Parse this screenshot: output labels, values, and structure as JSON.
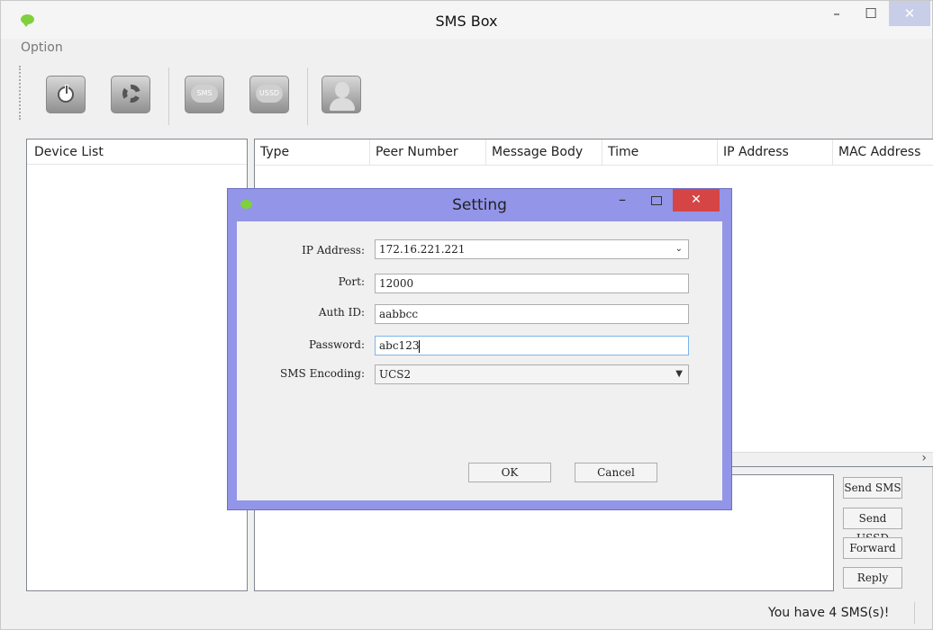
{
  "window": {
    "title": "SMS Box",
    "min_glyph": "–",
    "max_glyph": "☐",
    "close_glyph": "✕"
  },
  "menu": {
    "option": "Option"
  },
  "toolbar": {
    "sms_label": "SMS",
    "ussd_label": "USSD"
  },
  "device_list": {
    "title": "Device List"
  },
  "messages": {
    "columns": [
      "Type",
      "Peer Number",
      "Message Body",
      "Time",
      "IP Address",
      "MAC Address"
    ],
    "scroll_right_glyph": "›"
  },
  "actions": {
    "send_sms": "Send SMS",
    "send_ussd": "Send USSD",
    "forward": "Forward",
    "reply": "Reply"
  },
  "status": {
    "text": "You have 4 SMS(s)!"
  },
  "dialog": {
    "title": "Setting",
    "min_glyph": "–",
    "close_glyph": "✕",
    "fields": {
      "ip_label": "IP Address:",
      "ip_value": "172.16.221.221",
      "port_label": "Port:",
      "port_value": "12000",
      "auth_label": "Auth ID:",
      "auth_value": "aabbcc",
      "password_label": "Password:",
      "password_value": "abc123",
      "encoding_label": "SMS Encoding:",
      "encoding_value": "UCS2"
    },
    "ok": "OK",
    "cancel": "Cancel"
  },
  "colors": {
    "dialog_frame": "#9395e8",
    "close_red": "#d64545",
    "app_green": "#7fd13b"
  }
}
